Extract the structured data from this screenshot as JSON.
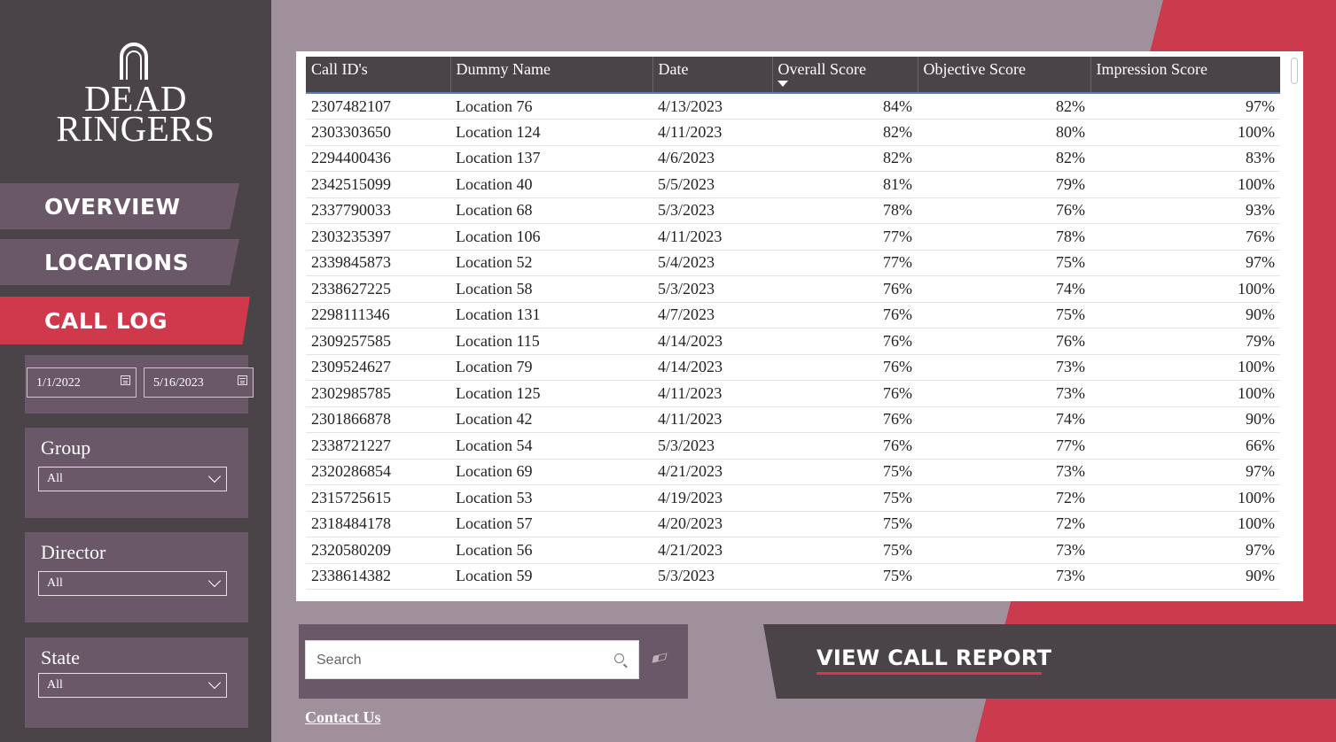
{
  "brand": {
    "line1": "DEAD",
    "line2": "RINGERS"
  },
  "nav": [
    {
      "label": "OVERVIEW",
      "active": false
    },
    {
      "label": "LOCATIONS",
      "active": false
    },
    {
      "label": "CALL LOG",
      "active": true
    }
  ],
  "date_range": {
    "start": "1/1/2022",
    "end": "5/16/2023"
  },
  "filters": {
    "group": {
      "label": "Group",
      "value": "All"
    },
    "director": {
      "label": "Director",
      "value": "All"
    },
    "state": {
      "label": "State",
      "value": "All"
    }
  },
  "table": {
    "columns": [
      "Call ID's",
      "Dummy Name",
      "Date",
      "Overall Score",
      "Objective Score",
      "Impression Score"
    ],
    "sorted_column": "Overall Score",
    "rows": [
      [
        "2307482107",
        "Location 76",
        "4/13/2023",
        "84%",
        "82%",
        "97%"
      ],
      [
        "2303303650",
        "Location 124",
        "4/11/2023",
        "82%",
        "80%",
        "100%"
      ],
      [
        "2294400436",
        "Location 137",
        "4/6/2023",
        "82%",
        "82%",
        "83%"
      ],
      [
        "2342515099",
        "Location 40",
        "5/5/2023",
        "81%",
        "79%",
        "100%"
      ],
      [
        "2337790033",
        "Location 68",
        "5/3/2023",
        "78%",
        "76%",
        "93%"
      ],
      [
        "2303235397",
        "Location 106",
        "4/11/2023",
        "77%",
        "78%",
        "76%"
      ],
      [
        "2339845873",
        "Location 52",
        "5/4/2023",
        "77%",
        "75%",
        "97%"
      ],
      [
        "2338627225",
        "Location 58",
        "5/3/2023",
        "76%",
        "74%",
        "100%"
      ],
      [
        "2298111346",
        "Location 131",
        "4/7/2023",
        "76%",
        "75%",
        "90%"
      ],
      [
        "2309257585",
        "Location 115",
        "4/14/2023",
        "76%",
        "76%",
        "79%"
      ],
      [
        "2309524627",
        "Location 79",
        "4/14/2023",
        "76%",
        "73%",
        "100%"
      ],
      [
        "2302985785",
        "Location 125",
        "4/11/2023",
        "76%",
        "73%",
        "100%"
      ],
      [
        "2301866878",
        "Location 42",
        "4/11/2023",
        "76%",
        "74%",
        "90%"
      ],
      [
        "2338721227",
        "Location 54",
        "5/3/2023",
        "76%",
        "77%",
        "66%"
      ],
      [
        "2320286854",
        "Location 69",
        "4/21/2023",
        "75%",
        "73%",
        "97%"
      ],
      [
        "2315725615",
        "Location 53",
        "4/19/2023",
        "75%",
        "72%",
        "100%"
      ],
      [
        "2318484178",
        "Location 57",
        "4/20/2023",
        "75%",
        "72%",
        "100%"
      ],
      [
        "2320580209",
        "Location 56",
        "4/21/2023",
        "75%",
        "73%",
        "97%"
      ],
      [
        "2338614382",
        "Location 59",
        "5/3/2023",
        "75%",
        "73%",
        "90%"
      ]
    ]
  },
  "search": {
    "placeholder": "Search"
  },
  "contact_label": "Contact Us",
  "report_button_label": "VIEW CALL REPORT",
  "colors": {
    "sidebar": "#4a4449",
    "panel": "#6a5868",
    "accent": "#d0384b",
    "background": "#a0909b"
  }
}
